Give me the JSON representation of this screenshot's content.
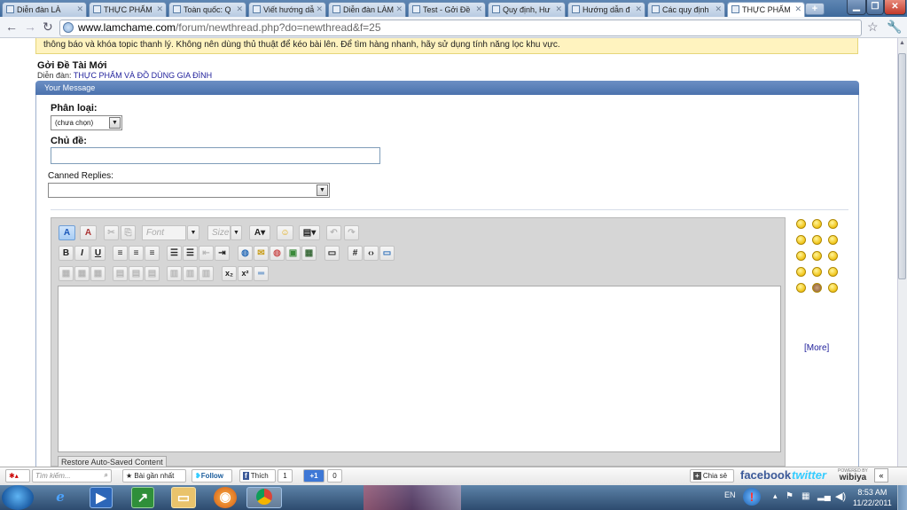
{
  "tabs": [
    {
      "label": "Diễn đàn LÀ"
    },
    {
      "label": "THỰC PHẨM"
    },
    {
      "label": "Toàn quốc: Q"
    },
    {
      "label": "Viết hướng dẫ"
    },
    {
      "label": "Diễn đàn LÀM"
    },
    {
      "label": "Test - Gởi Đề"
    },
    {
      "label": "Quy định, Hư"
    },
    {
      "label": "Hướng dẫn đ"
    },
    {
      "label": "Các quy định"
    },
    {
      "label": "THỰC PHẨM"
    }
  ],
  "address": {
    "domain": "www.lamchame.com",
    "path": "/forum/newthread.php?do=newthread&f=25"
  },
  "notice": "thông báo và khóa topic thanh lý. Không nên dùng thủ thuật để kéo bài lên. Để tìm hàng nhanh, hãy sử dụng tính năng lọc khu vực.",
  "page": {
    "heading": "Gởi Đề Tài Mới",
    "forum_prefix": "Diễn đàn:",
    "forum_name": "THỰC PHẨM VÀ ĐỒ DÙNG GIA ĐÌNH",
    "panel_title": "Your Message"
  },
  "form": {
    "category_label": "Phân loại:",
    "category_value": "(chưa chọn)",
    "subject_label": "Chủ đề:",
    "subject_value": "",
    "canned_label": "Canned Replies:",
    "canned_value": ""
  },
  "editor": {
    "font_placeholder": "Font",
    "size_placeholder": "Size",
    "autosave_label": "Restore Auto-Saved Content",
    "more_smilies": "[More]"
  },
  "wibiya": {
    "recent_posts": "Bài gần nhất",
    "follow": "Follow",
    "like": "Thích",
    "like_count": "1",
    "plusone": "+1",
    "plusone_count": "0",
    "share": "Chia sẻ",
    "facebook": "facebook",
    "twitter": "twitter",
    "search_placeholder": "Tìm kiếm...",
    "powered_by": "POWERED BY",
    "brand": "wibiya"
  },
  "taskbar": {
    "lang": "EN",
    "time": "8:53 AM",
    "date": "11/22/2011"
  },
  "colors": {
    "panel_header": "#4b72ad",
    "link": "#22229c",
    "notice_bg": "#fff3bf",
    "facebook": "#3b5998",
    "twitter": "#35ccff"
  }
}
